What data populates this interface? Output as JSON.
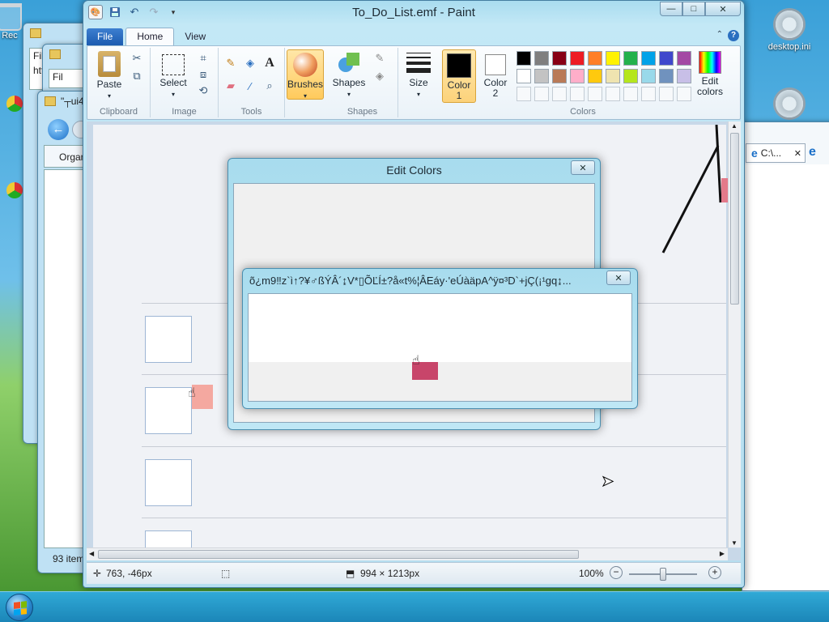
{
  "desktop": {
    "icons": [
      {
        "label": "desktop.ini",
        "icon": "gear-icon"
      },
      {
        "label": "Rec",
        "icon": "recycle-bin-icon"
      }
    ]
  },
  "background_windows": {
    "ie_tab_label": "C:\\...",
    "explorer_title": "\"┬ui4",
    "explorer_toolbar": "Organ",
    "explorer_status": "93 item",
    "addr_fragment": "htt",
    "menu_fragment_1": "Fil",
    "menu_fragment_2": "Fil"
  },
  "paint": {
    "title": "To_Do_List.emf - Paint",
    "qat": {
      "save": "save-icon",
      "undo": "undo-icon",
      "redo": "redo-icon"
    },
    "caption": {
      "minimize": "—",
      "maximize": "□",
      "close": "✕"
    },
    "tabs": [
      {
        "label": "File"
      },
      {
        "label": "Home"
      },
      {
        "label": "View"
      }
    ],
    "groups": {
      "clipboard": "Clipboard",
      "image": "Image",
      "tools": "Tools",
      "shapes": "Shapes",
      "colors": "Colors"
    },
    "buttons": {
      "paste": "Paste",
      "select": "Select",
      "brushes": "Brushes",
      "shapes": "Shapes",
      "size": "Size",
      "color1": "Color 1",
      "color2": "Color 2",
      "edit_colors": "Edit colors"
    },
    "palette": [
      "#000000",
      "#7f7f7f",
      "#880015",
      "#ed1c24",
      "#ff7f27",
      "#fff200",
      "#22b14c",
      "#00a2e8",
      "#3f48cc",
      "#a349a4",
      "#ffffff",
      "#c3c3c3",
      "#b97a57",
      "#ffaec9",
      "#ffc90e",
      "#efe4b0",
      "#b5e61d",
      "#99d9ea",
      "#7092be",
      "#c8bfe7"
    ],
    "color1": "#000000",
    "color2": "#ffffff",
    "status": {
      "cursor_pos": "763, -46px",
      "image_size": "994 × 1213px",
      "zoom": "100%"
    }
  },
  "dialogs": {
    "edit_colors": {
      "title": "Edit Colors",
      "close": "✕"
    },
    "garbled": {
      "title": "õ¿m9‼z`ì↑?¥♂ßÝÂ´↨V*▯ÕĽÍ±?å«t%¦ÂEáy·'eÚàäpA^ÿ¤³D`+jÇ(¡¹gq↨...",
      "close": "✕"
    }
  },
  "taskbar": {
    "start": "start-button"
  }
}
